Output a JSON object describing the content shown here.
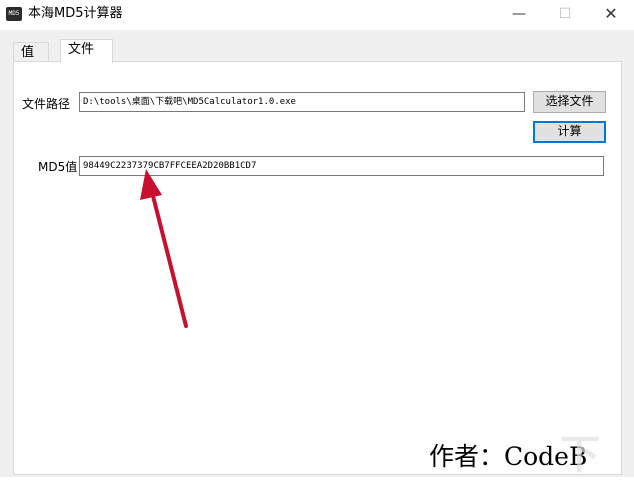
{
  "window": {
    "title": "本海MD5计算器",
    "icon_text": "MD5",
    "minimize_glyph": "—",
    "maximize_glyph": "☐",
    "close_glyph": "✕"
  },
  "tabs": [
    {
      "label": "值"
    },
    {
      "label": "文件",
      "active": true
    }
  ],
  "file_path": {
    "label": "文件路径",
    "value": "D:\\tools\\桌面\\下载吧\\MD5Calculator1.0.exe",
    "browse_button": "选择文件"
  },
  "compute_button": "计算",
  "md5": {
    "label": "MD5值",
    "value": "98449C2237379CB7FFCEEA2D20BB1CD7"
  },
  "author_text": "作者：CodeB",
  "colors": {
    "arrow": "#c8102e",
    "focus_border": "#0078d7",
    "panel_bg": "#f0f0f0"
  }
}
